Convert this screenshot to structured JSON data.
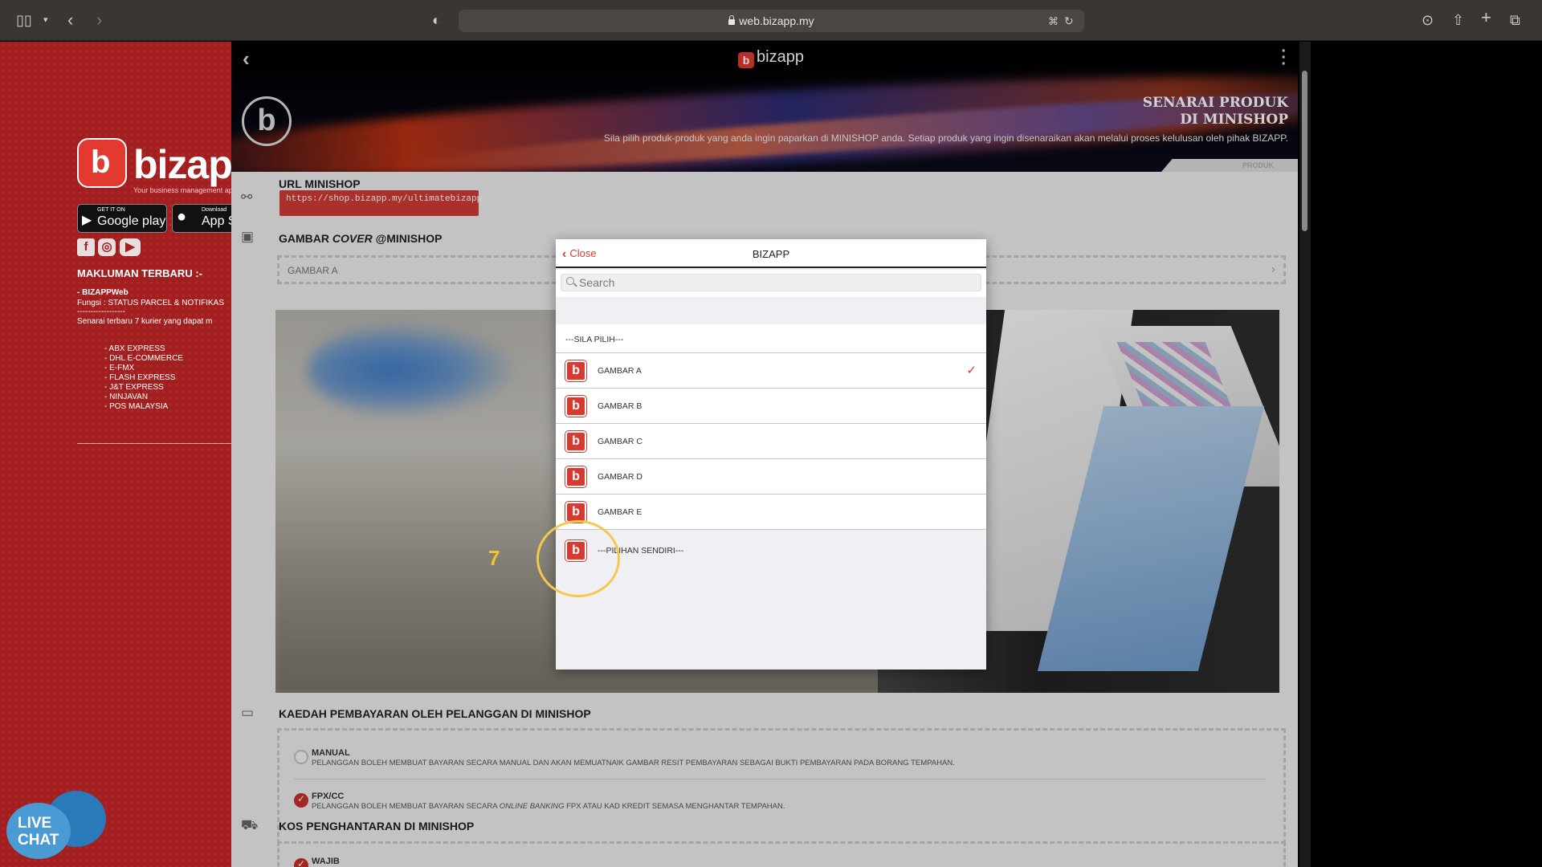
{
  "browser": {
    "url": "web.bizapp.my"
  },
  "left_panel": {
    "logo_text": "bizapp",
    "logo_letter": "b",
    "tagline": "Your business management app",
    "google_play": {
      "small": "GET IT ON",
      "big": "Google play"
    },
    "app_store": {
      "small": "Download",
      "big": "App S"
    },
    "news_heading": "MAKLUMAN TERBARU :-",
    "news_sub": "- BIZAPPWeb",
    "news_lines": [
      "Fungsi : STATUS PARCEL & NOTIFIKAS",
      "------------------",
      "Senarai terbaru 7 kurier yang dapat m"
    ],
    "couriers": [
      "- ABX EXPRESS",
      "- DHL E-COMMERCE",
      "- E-FMX",
      "- FLASH EXPRESS",
      "- J&T EXPRESS",
      "- NINJAVAN",
      "- POS MALAYSIA"
    ],
    "live_chat": {
      "line1": "LIVE",
      "line2": "CHAT"
    }
  },
  "hero": {
    "logo_text": "bizapp",
    "title_line1": "SENARAI PRODUK",
    "title_line2": "DI MINISHOP",
    "description": "Sila pilih produk-produk yang anda ingin paparkan di MINISHOP anda. Setiap produk yang ingin disenaraikan akan melalui proses kelulusan oleh pihak BIZAPP.",
    "tab": "PRODUK"
  },
  "sections": {
    "url_title": "URL MINISHOP",
    "url_value": "https://shop.bizapp.my/ultimatebizapp",
    "cover_title_pre": "GAMBAR ",
    "cover_title_em": "COVER",
    "cover_title_post": " @MINISHOP",
    "cover_selected": "GAMBAR A",
    "payment_title": "KAEDAH PEMBAYARAN OLEH PELANGGAN DI MINISHOP",
    "payment_options": [
      {
        "label": "MANUAL",
        "desc": "PELANGGAN BOLEH MEMBUAT BAYARAN SECARA MANUAL DAN AKAN MEMUATNAIK GAMBAR RESIT PEMBAYARAN SEBAGAI BUKTI PEMBAYARAN PADA BORANG TEMPAHAN.",
        "checked": false
      },
      {
        "label": "FPX/CC",
        "desc_pre": "PELANGGAN BOLEH MEMBUAT BAYARAN SECARA ",
        "desc_em": "ONLINE BANKING",
        "desc_post": " FPX ATAU KAD KREDIT SEMASA MENGHANTAR TEMPAHAN.",
        "checked": true
      }
    ],
    "shipping_title": "KOS PENGHANTARAN DI MINISHOP",
    "shipping_option": "WAJIB"
  },
  "modal": {
    "close_label": "Close",
    "title": "BIZAPP",
    "search_placeholder": "Search",
    "placeholder_option": "---SILA PILIH---",
    "options": [
      "GAMBAR A",
      "GAMBAR B",
      "GAMBAR C",
      "GAMBAR D",
      "GAMBAR E"
    ],
    "selected": "GAMBAR A",
    "custom_option": "---PILIHAN SENDIRI---"
  },
  "annotation": {
    "step_number": "7",
    "color": "#f2c94c"
  }
}
